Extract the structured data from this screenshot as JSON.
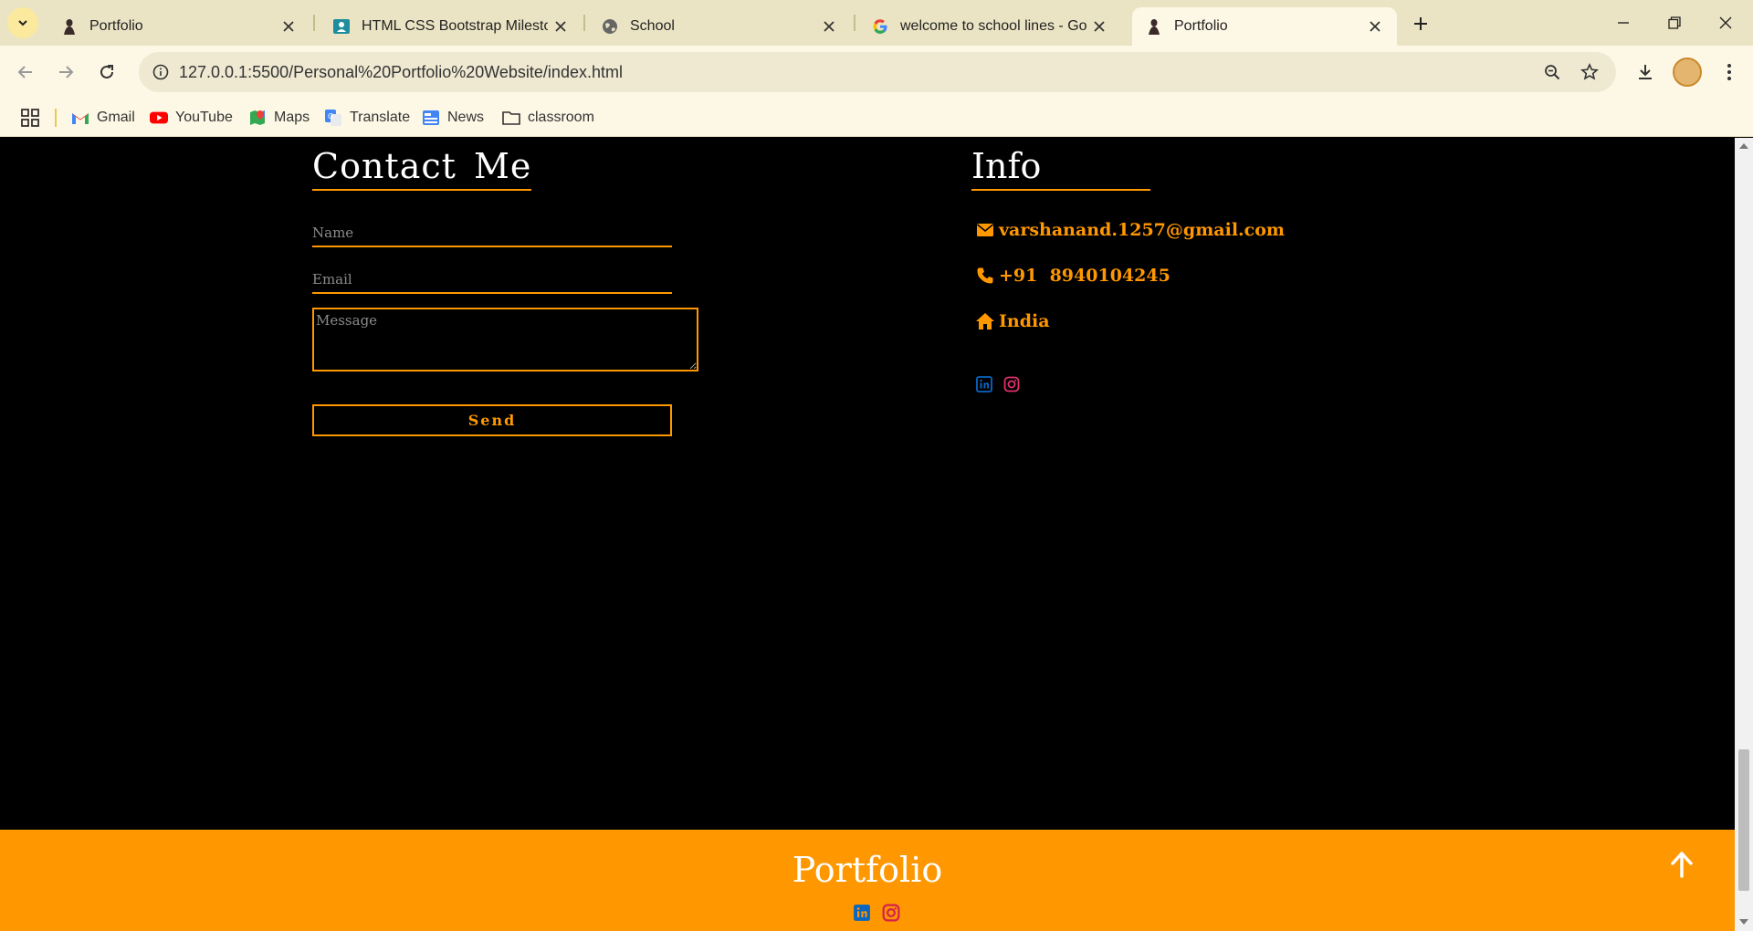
{
  "browser": {
    "tabs": [
      {
        "title": "Portfolio",
        "favicon": "portfolio-favicon",
        "active": false
      },
      {
        "title": "HTML CSS Bootstrap Milestone",
        "favicon": "classroom-favicon",
        "active": false
      },
      {
        "title": "School",
        "favicon": "globe-favicon",
        "active": false
      },
      {
        "title": "welcome to school lines - Goog",
        "favicon": "google-favicon",
        "active": false
      },
      {
        "title": "Portfolio",
        "favicon": "portfolio-favicon",
        "active": true
      }
    ],
    "url": "127.0.0.1:5500/Personal%20Portfolio%20Website/index.html",
    "bookmarks": [
      {
        "label": "Gmail",
        "icon": "gmail-icon"
      },
      {
        "label": "YouTube",
        "icon": "youtube-icon"
      },
      {
        "label": "Maps",
        "icon": "maps-icon"
      },
      {
        "label": "Translate",
        "icon": "translate-icon"
      },
      {
        "label": "News",
        "icon": "news-icon"
      },
      {
        "label": "classroom",
        "icon": "folder-icon"
      }
    ]
  },
  "contact": {
    "title": "Contact Me",
    "name_placeholder": "Name",
    "email_placeholder": "Email",
    "message_placeholder": "Message",
    "send_label": "Send"
  },
  "info": {
    "title": "Info",
    "email": "varshanand.1257@gmail.com",
    "phone": "+91  8940104245",
    "location": "India"
  },
  "footer": {
    "title": "Portfolio"
  },
  "colors": {
    "accent": "#ff9800",
    "background": "#000000",
    "linkedin": "#0a66c2",
    "instagram": "#e1306c"
  }
}
